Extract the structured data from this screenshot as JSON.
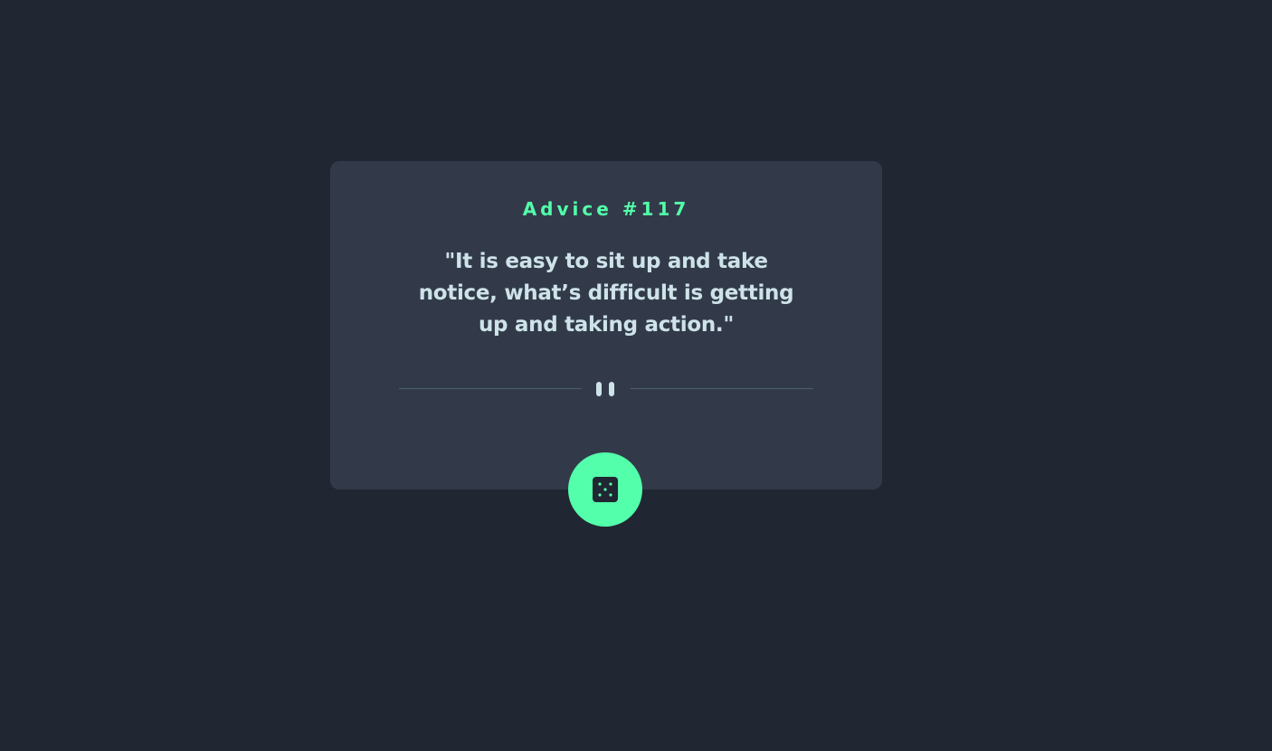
{
  "advice": {
    "label": "Advice #117",
    "quote": "\"It is easy to sit up and take notice, what’s difficult is getting up and taking action.\""
  },
  "icons": {
    "divider": "pause-icon",
    "button": "dice-icon"
  },
  "colors": {
    "background": "#202632",
    "card": "#323a49",
    "accent": "#53ffaa",
    "text": "#cee3e9",
    "divider_line": "#4f5d74"
  }
}
